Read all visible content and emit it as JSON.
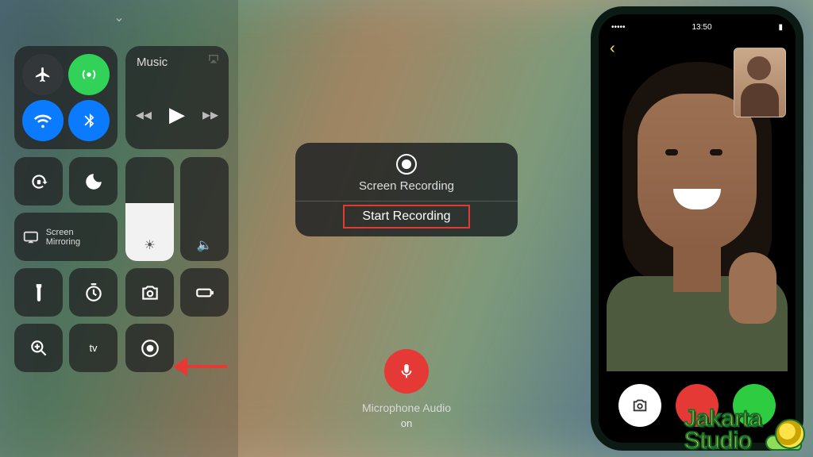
{
  "control_center": {
    "music_label": "Music",
    "screen_mirroring_label": "Screen\nMirroring",
    "apple_tv_label": "tv"
  },
  "sheet": {
    "title": "Screen Recording",
    "action": "Start Recording"
  },
  "mic": {
    "label": "Microphone Audio",
    "state": "on"
  },
  "phone": {
    "carrier": "•••••",
    "time": "13:50"
  },
  "logo": {
    "line1": "Jakarta",
    "line2": "Studio"
  }
}
